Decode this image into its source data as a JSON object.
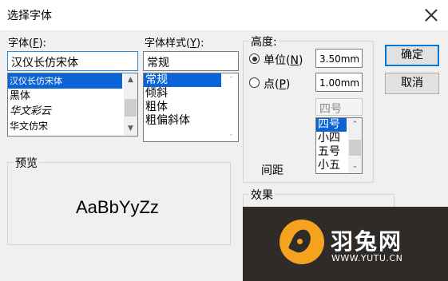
{
  "window": {
    "title": "选择字体"
  },
  "font": {
    "label": "字体",
    "accel": "(F):",
    "accel_letter": "F",
    "value": "汉仪长仿宋体",
    "items": [
      "汉仪长仿宋体",
      "黑体",
      "华文彩云",
      "华文仿宋"
    ],
    "selected": "汉仪长仿宋体"
  },
  "style": {
    "label": "字体样式",
    "accel_letter": "Y",
    "value": "常规",
    "items": [
      "常规",
      "倾斜",
      "粗体",
      "粗偏斜体"
    ]
  },
  "height": {
    "group_label": "高度:",
    "unit_label": "单位",
    "unit_accel": "N",
    "unit_value": "3.50mm",
    "point_label": "点",
    "point_accel": "P",
    "point_value": "1.00mm",
    "size_value": "四号",
    "size_items": [
      "四号",
      "小四",
      "五号",
      "小五"
    ],
    "spacing_label": "间距"
  },
  "buttons": {
    "ok": "确定",
    "cancel": "取消"
  },
  "preview": {
    "label": "预览",
    "sample": "AaBbYyZz"
  },
  "effects": {
    "label": "效果"
  },
  "watermark": {
    "brand": "羽兔网",
    "url": "WWW.YUTU.CN"
  }
}
